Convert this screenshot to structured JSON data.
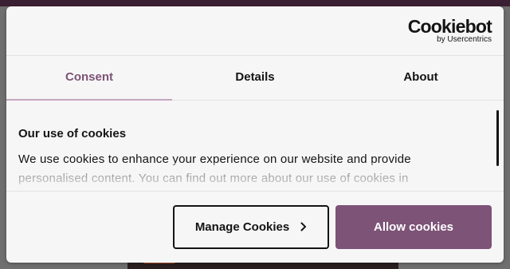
{
  "brand": {
    "logo_main": "Cookiebot",
    "logo_sub": "by Usercentrics"
  },
  "tabs": [
    {
      "label": "Consent",
      "active": true
    },
    {
      "label": "Details",
      "active": false
    },
    {
      "label": "About",
      "active": false
    }
  ],
  "consent": {
    "title": "Our use of cookies",
    "text": "We use cookies to enhance your experience on our website and provide personalised content. You can find out more about our use of cookies in"
  },
  "buttons": {
    "manage": "Manage Cookies",
    "allow": "Allow cookies"
  },
  "colors": {
    "accent": "#7d5377",
    "tab_underline": "#c6a6c1",
    "text": "#141414",
    "dialog_bg": "#f6f6f6"
  },
  "icons": {
    "manage_chevron": "chevron-right-icon"
  }
}
